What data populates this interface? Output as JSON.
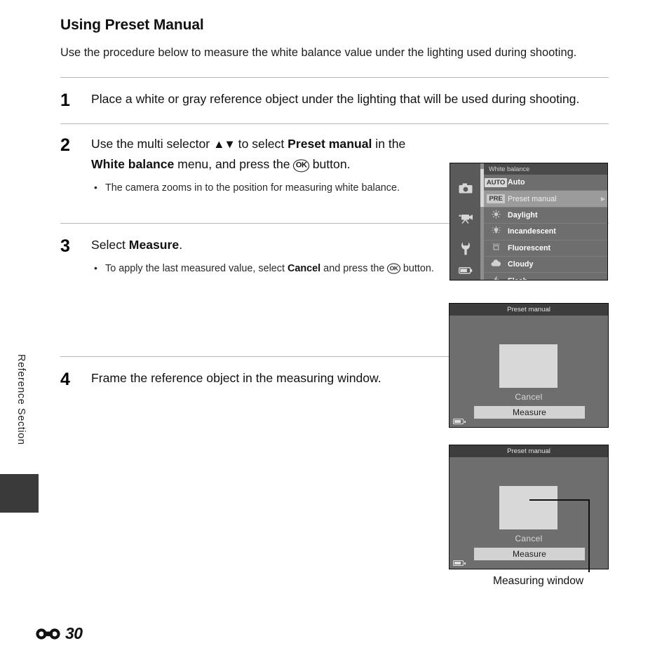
{
  "page": {
    "section_label": "Reference Section",
    "folio_number": "30",
    "folio_icon": "reference-section-icon"
  },
  "section": {
    "title": "Using Preset Manual",
    "intro": "Use the procedure below to measure the white balance value under the lighting used during shooting."
  },
  "steps": [
    {
      "number": "1",
      "text_parts": [
        {
          "t": "Place a white or gray reference object under the lighting that will be used during shooting.",
          "b": false
        }
      ],
      "bullets": []
    },
    {
      "number": "2",
      "text_parts": [
        {
          "t": "Use the multi selector ",
          "b": false
        },
        {
          "t": "▲▼",
          "b": false,
          "cls": "updown"
        },
        {
          "t": " to select ",
          "b": false
        },
        {
          "t": "Preset manual",
          "b": true
        },
        {
          "t": " in the ",
          "b": false
        },
        {
          "t": "White balance",
          "b": true
        },
        {
          "t": " menu, and press the ",
          "b": false
        },
        {
          "t": "OK",
          "b": false,
          "cls": "ok"
        },
        {
          "t": " button.",
          "b": false
        }
      ],
      "bullets": [
        [
          {
            "t": "The camera zooms in to the position for measuring white balance.",
            "b": false
          }
        ]
      ]
    },
    {
      "number": "3",
      "text_parts": [
        {
          "t": "Select ",
          "b": false
        },
        {
          "t": "Measure",
          "b": true
        },
        {
          "t": ".",
          "b": false
        }
      ],
      "bullets": [
        [
          {
            "t": "To apply the last measured value, select ",
            "b": false
          },
          {
            "t": "Cancel",
            "b": true
          },
          {
            "t": " and press the ",
            "b": false
          },
          {
            "t": "OK",
            "b": false,
            "cls": "ok-sm"
          },
          {
            "t": " button.",
            "b": false
          }
        ]
      ]
    },
    {
      "number": "4",
      "text_parts": [
        {
          "t": "Frame the reference object in the measuring window.",
          "b": false
        }
      ],
      "bullets": []
    }
  ],
  "white_balance_screen": {
    "title": "White balance",
    "sidebar_icons": [
      {
        "name": "shooting-menu-icon",
        "glyph": "▣"
      },
      {
        "name": "movie-menu-icon",
        "glyph": "▶"
      },
      {
        "name": "setup-menu-icon",
        "glyph": "⚒"
      },
      {
        "name": "battery-icon",
        "glyph": "▭"
      }
    ],
    "items": [
      {
        "badge": "AUTO",
        "icon": null,
        "label": "Auto",
        "selected": false,
        "arrow": ""
      },
      {
        "badge": "PRE",
        "icon": null,
        "label": "Preset manual",
        "selected": true,
        "arrow": "▶"
      },
      {
        "badge": null,
        "icon": "daylight-icon",
        "label": "Daylight",
        "selected": false,
        "arrow": ""
      },
      {
        "badge": null,
        "icon": "incandescent-icon",
        "label": "Incandescent",
        "selected": false,
        "arrow": ""
      },
      {
        "badge": null,
        "icon": "fluorescent-icon",
        "label": "Fluorescent",
        "selected": false,
        "arrow": ""
      },
      {
        "badge": null,
        "icon": "cloudy-icon",
        "label": "Cloudy",
        "selected": false,
        "arrow": ""
      },
      {
        "badge": null,
        "icon": "flash-icon",
        "label": "Flash",
        "selected": false,
        "arrow": ""
      }
    ]
  },
  "preset_manual_screen": {
    "title": "Preset manual",
    "cancel_label": "Cancel",
    "measure_label": "Measure"
  },
  "callout": {
    "label": "Measuring window"
  },
  "colors": {
    "lcd_background": "#6e6e6e",
    "lcd_titlebar": "#3d3d3d",
    "lcd_sidebar": "#5a5a5a",
    "lcd_selected_row": "#9b9b9b",
    "measuring_window": "#d8d8d8",
    "measure_button": "#d2d2d2",
    "rule": "#b9b9b9",
    "section_tab": "#3a3a3a"
  }
}
